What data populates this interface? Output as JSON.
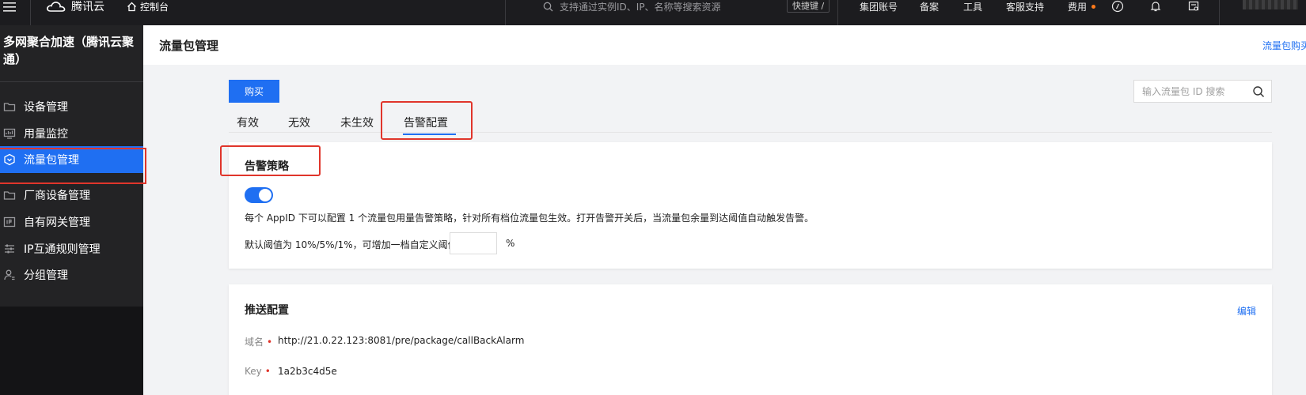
{
  "topbar": {
    "brand": "腾讯云",
    "console": "控制台",
    "search_placeholder": "支持通过实例ID、IP、名称等搜索资源",
    "shortcut": "快捷键 /",
    "links": [
      "集团账号",
      "备案",
      "工具",
      "客服支持",
      "费用"
    ]
  },
  "sidebar": {
    "product": "多网聚合加速（腾讯云聚通）",
    "items": [
      {
        "label": "设备管理",
        "icon": "folder-icon"
      },
      {
        "label": "用量监控",
        "icon": "monitor-icon"
      },
      {
        "label": "流量包管理",
        "icon": "package-icon"
      },
      {
        "label": "厂商设备管理",
        "icon": "folder-icon"
      },
      {
        "label": "自有网关管理",
        "icon": "ip-icon"
      },
      {
        "label": "IP互通规则管理",
        "icon": "sliders-icon"
      },
      {
        "label": "分组管理",
        "icon": "group-icon"
      }
    ],
    "active_index": 2
  },
  "page": {
    "title": "流量包管理",
    "header_link": "流量包购买"
  },
  "toolbar": {
    "buy_label": "购买",
    "search_placeholder": "输入流量包 ID 搜索"
  },
  "tabs": [
    "有效",
    "无效",
    "未生效",
    "告警配置"
  ],
  "active_tab": 3,
  "alarm": {
    "title": "告警策略",
    "enabled": true,
    "description": "每个 AppID 下可以配置 1 个流量包用量告警策略，针对所有档位流量包生效。打开告警开关后，当流量包余量到达阈值自动触发告警。",
    "threshold_label": "默认阈值为 10%/5%/1%，可增加一档自定义阈值",
    "threshold_value": "",
    "unit": "%"
  },
  "push": {
    "title": "推送配置",
    "edit_label": "编辑",
    "domain_label": "域名",
    "domain_value": "http://21.0.22.123:8081/pre/package/callBackAlarm",
    "key_label": "Key",
    "key_value": "1a2b3c4d5e"
  },
  "colors": {
    "primary": "#1f6ff2",
    "highlight": "#e0352b",
    "sidebar_bg": "#232325",
    "topbar_bg": "#1c1c1f"
  }
}
